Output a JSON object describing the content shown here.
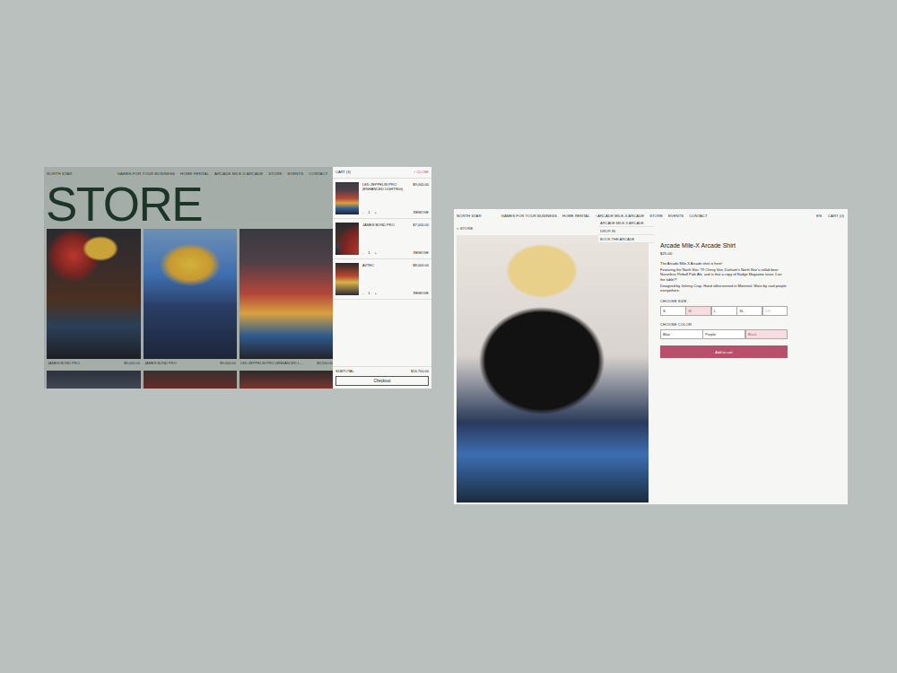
{
  "left_screen": {
    "nav": {
      "brand": "NORTH STAR",
      "items": [
        "GAMES FOR YOUR BUSINESS",
        "HOME RENTAL",
        "ARCADE MILE-X ARCADE",
        "STORE",
        "EVENTS",
        "CONTACT"
      ]
    },
    "title": "STORE",
    "products": [
      {
        "name": "JAMES BOND PRO",
        "price": "$9,000.00"
      },
      {
        "name": "JAMES BOND PRO",
        "price": "$9,000.00"
      },
      {
        "name": "LED ZEPPELIN PRO (ENHANCED L...",
        "price": "$9,500.00"
      }
    ],
    "cart": {
      "title": "CART (3)",
      "close": "× CLOSE",
      "items": [
        {
          "name": "LED ZEPPELIN PRO (ENHANCED LIGHTING)",
          "price": "$9,000.00",
          "minus": "-",
          "qty": "1",
          "plus": "+",
          "remove": "REMOVE"
        },
        {
          "name": "JAMES BOND PRO",
          "price": "$7,000.00",
          "minus": "-",
          "qty": "1",
          "plus": "+",
          "remove": "REMOVE"
        },
        {
          "name": "AZTEC",
          "price": "$8,000.00",
          "minus": "-",
          "qty": "1",
          "plus": "+",
          "remove": "REMOVE"
        }
      ],
      "subtotal_label": "SUBTOTAL",
      "subtotal": "$24,700.00",
      "checkout": "Checkout"
    }
  },
  "right_screen": {
    "nav": {
      "brand": "NORTH STAR",
      "items": [
        "GAMES FOR YOUR BUSINESS",
        "HOME RENTAL",
        "› ARCADE MILE-X ARCADE",
        "STORE",
        "EVENTS",
        "CONTACT"
      ],
      "language": "EN",
      "cart": "CART (0)"
    },
    "dropdown": [
      "ARCADE MILE-X ARCADE",
      "DROP-IN",
      "BOOK THE ARCADE"
    ],
    "back": "< STORE",
    "product": {
      "title": "Arcade Mile-X Arcade Shirt",
      "price": "$25.00",
      "description": [
        "The Arcade Mile-X Arcade shirt is here!",
        "Featuring the North Star '79 Chevy Van, Durham's North Star's collab beer Nurseless Pinball Pale Ale, and is that a copy of Nudge Magazine issue 1 on the table?!",
        "Designed by Johnny Crap. Hand silkscreened in Montreal. Worn by cool people everywhere."
      ],
      "size_label": "CHOOSE SIZE",
      "sizes": [
        {
          "label": "S",
          "selected": false,
          "disabled": false
        },
        {
          "label": "M",
          "selected": true,
          "disabled": false
        },
        {
          "label": "L",
          "selected": false,
          "disabled": false
        },
        {
          "label": "XL",
          "selected": false,
          "disabled": false
        },
        {
          "label": "XXL",
          "selected": false,
          "disabled": true
        }
      ],
      "color_label": "CHOOSE COLOR",
      "colors": [
        {
          "label": "Blue",
          "selected": false
        },
        {
          "label": "Purple",
          "selected": false
        },
        {
          "label": "Black",
          "selected": true
        }
      ],
      "add_to_cart": "Add to cart"
    }
  }
}
